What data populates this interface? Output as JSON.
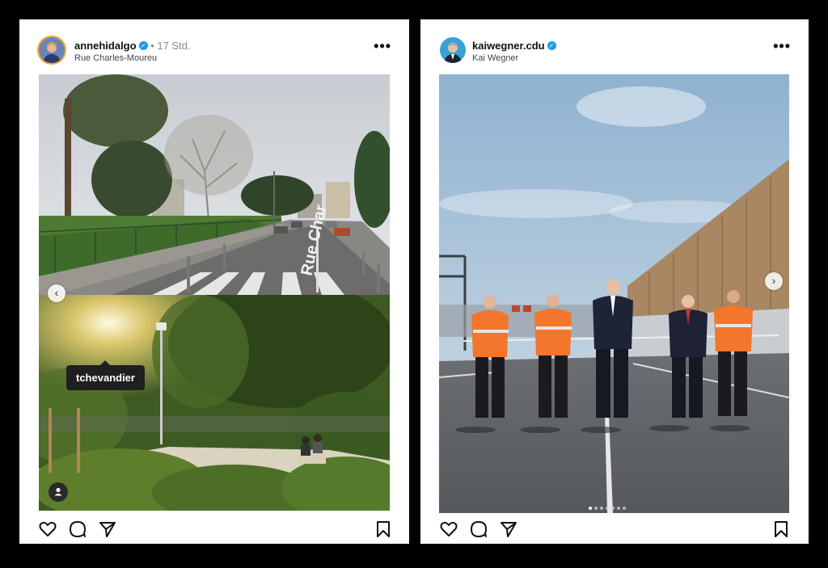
{
  "posts": [
    {
      "username": "annehidalgo",
      "time": "17 Std.",
      "location": "Rue Charles-Moureu",
      "street_sign": "Rue Char",
      "tag_label": "tchevandier"
    },
    {
      "username": "kaiwegner.cdu",
      "subtitle": "Kai Wegner",
      "carousel_count": 7,
      "carousel_index": 1
    }
  ],
  "icons": {
    "verified": "verified-badge-icon",
    "more": "more-options-icon",
    "like": "heart-icon",
    "comment": "comment-icon",
    "share": "send-icon",
    "save": "bookmark-icon",
    "prev": "chevron-left-icon",
    "next": "chevron-right-icon",
    "user_tags": "person-icon"
  },
  "colors": {
    "verified": "#1d9bf0",
    "story_ring": "#f5a623"
  }
}
